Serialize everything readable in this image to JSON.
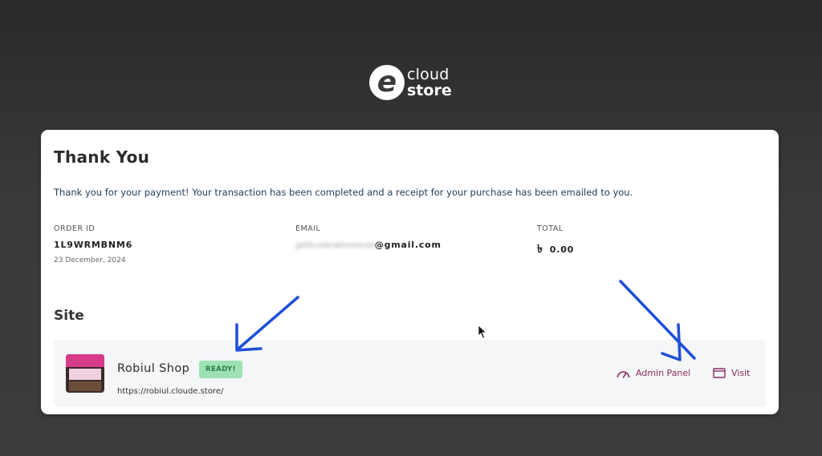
{
  "brand": {
    "mark": "e",
    "line1": "cloud",
    "line2": "store"
  },
  "receipt": {
    "title": "Thank You",
    "message": "Thank you for your payment! Your transaction has been completed and a receipt for your purchase has been emailed to you.",
    "order": {
      "label": "ORDER ID",
      "value": "1L9WRMBNM6",
      "date": "23 December, 2024"
    },
    "email": {
      "label": "EMAIL",
      "value_hidden": "gethcolerwhoolersd",
      "value_visible": "@gmail.com"
    },
    "total": {
      "label": "TOTAL",
      "currency_symbol": "৳",
      "value": "0.00"
    }
  },
  "site_section": {
    "title": "Site",
    "site": {
      "name": "Robiul Shop",
      "status": "READY!",
      "url": "https://robiul.cloude.store/",
      "admin_label": "Admin Panel",
      "visit_label": "Visit"
    }
  },
  "colors": {
    "background": "#333333",
    "card": "#ffffff",
    "accent": "#8a2c5f",
    "badge_bg": "#9ee2b4",
    "badge_text": "#2a7a47",
    "annotation_arrow": "#1f4fd8"
  },
  "icons": [
    "e-logo-icon",
    "speedometer-icon",
    "window-icon",
    "mouse-cursor-icon",
    "arrow-annotation-icon"
  ]
}
